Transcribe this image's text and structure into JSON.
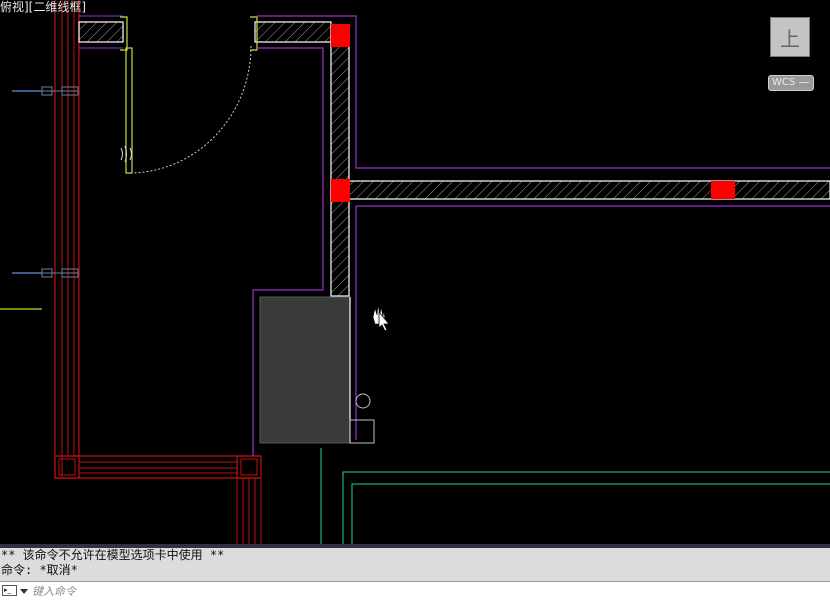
{
  "viewport": {
    "view_label": "俯视][二维线框]",
    "viewcube_label": "上",
    "wcs_label": "WCS"
  },
  "command_history": [
    "** 该命令不允许在模型选项卡中使用 **",
    "命令: *取消*"
  ],
  "command_line": {
    "placeholder": "键入命令",
    "icon_text": "▸_"
  },
  "colors": {
    "background": "#000000",
    "wall_outline": "#9b2fd1",
    "column": "#ff0000",
    "window_frame": "#c01010",
    "door": "#c8e03a",
    "cabinet": "#3a3a3a",
    "teal_lines": "#1fd0a8"
  }
}
